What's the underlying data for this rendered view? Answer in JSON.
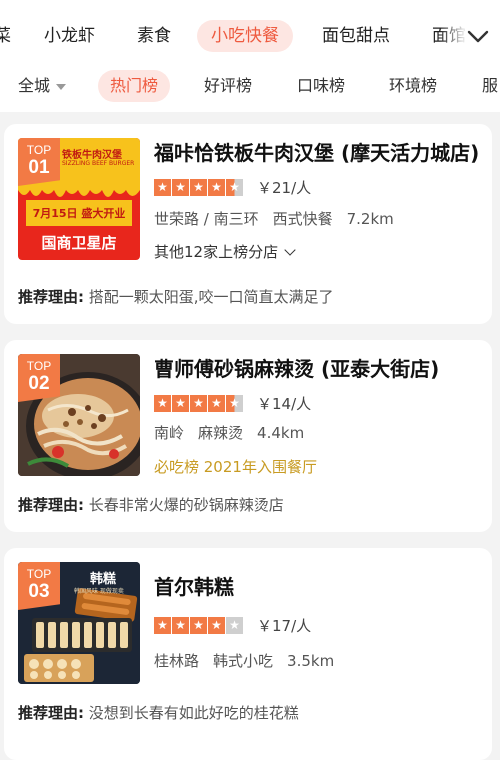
{
  "categories": [
    {
      "label": "菜",
      "active": false
    },
    {
      "label": "小龙虾",
      "active": false
    },
    {
      "label": "素食",
      "active": false
    },
    {
      "label": "小吃快餐",
      "active": true
    },
    {
      "label": "面包甜点",
      "active": false
    },
    {
      "label": "面馆",
      "active": false
    }
  ],
  "rank_tabs": [
    {
      "label": "全城",
      "active": false
    },
    {
      "label": "热门榜",
      "active": true
    },
    {
      "label": "好评榜",
      "active": false
    },
    {
      "label": "口味榜",
      "active": false
    },
    {
      "label": "环境榜",
      "active": false
    },
    {
      "label": "服",
      "active": false
    }
  ],
  "colors": {
    "accent": "#f27a45",
    "active_text": "#ee5a3f",
    "award": "#c89b22"
  },
  "reason_label": "推荐理由:",
  "cards": [
    {
      "badge_top": "TOP",
      "badge_num": "01",
      "title": "福咔恰铁板牛肉汉堡 (摩天活力城店)",
      "rating": 4.5,
      "price": "￥21/人",
      "meta": [
        "世荣路 / 南三环",
        "西式快餐",
        "7.2km"
      ],
      "extra": "其他12家上榜分店",
      "reason": "搭配一颗太阳蛋,咬一口简直太满足了",
      "image": {
        "line1": "铁板牛肉汉堡",
        "line2": "SIZZLING BEEF BURGER",
        "line3": "7月15日 盛大开业",
        "line4": "国商卫星店"
      }
    },
    {
      "badge_top": "TOP",
      "badge_num": "02",
      "title": "曹师傅砂锅麻辣烫 (亚泰大街店)",
      "rating": 4.5,
      "price": "￥14/人",
      "meta": [
        "南岭",
        "麻辣烫",
        "4.4km"
      ],
      "extra": "必吃榜 2021年入围餐厅",
      "reason": "长春非常火爆的砂锅麻辣烫店"
    },
    {
      "badge_top": "TOP",
      "badge_num": "03",
      "title": "首尔韩糕",
      "rating": 4,
      "price": "￥17/人",
      "meta": [
        "桂林路",
        "韩式小吃",
        "3.5km"
      ],
      "extra": "",
      "reason": "没想到长春有如此好吃的桂花糕",
      "image": {
        "line1": "韩糕",
        "line2": "韩国风味 现做现卖"
      }
    }
  ]
}
